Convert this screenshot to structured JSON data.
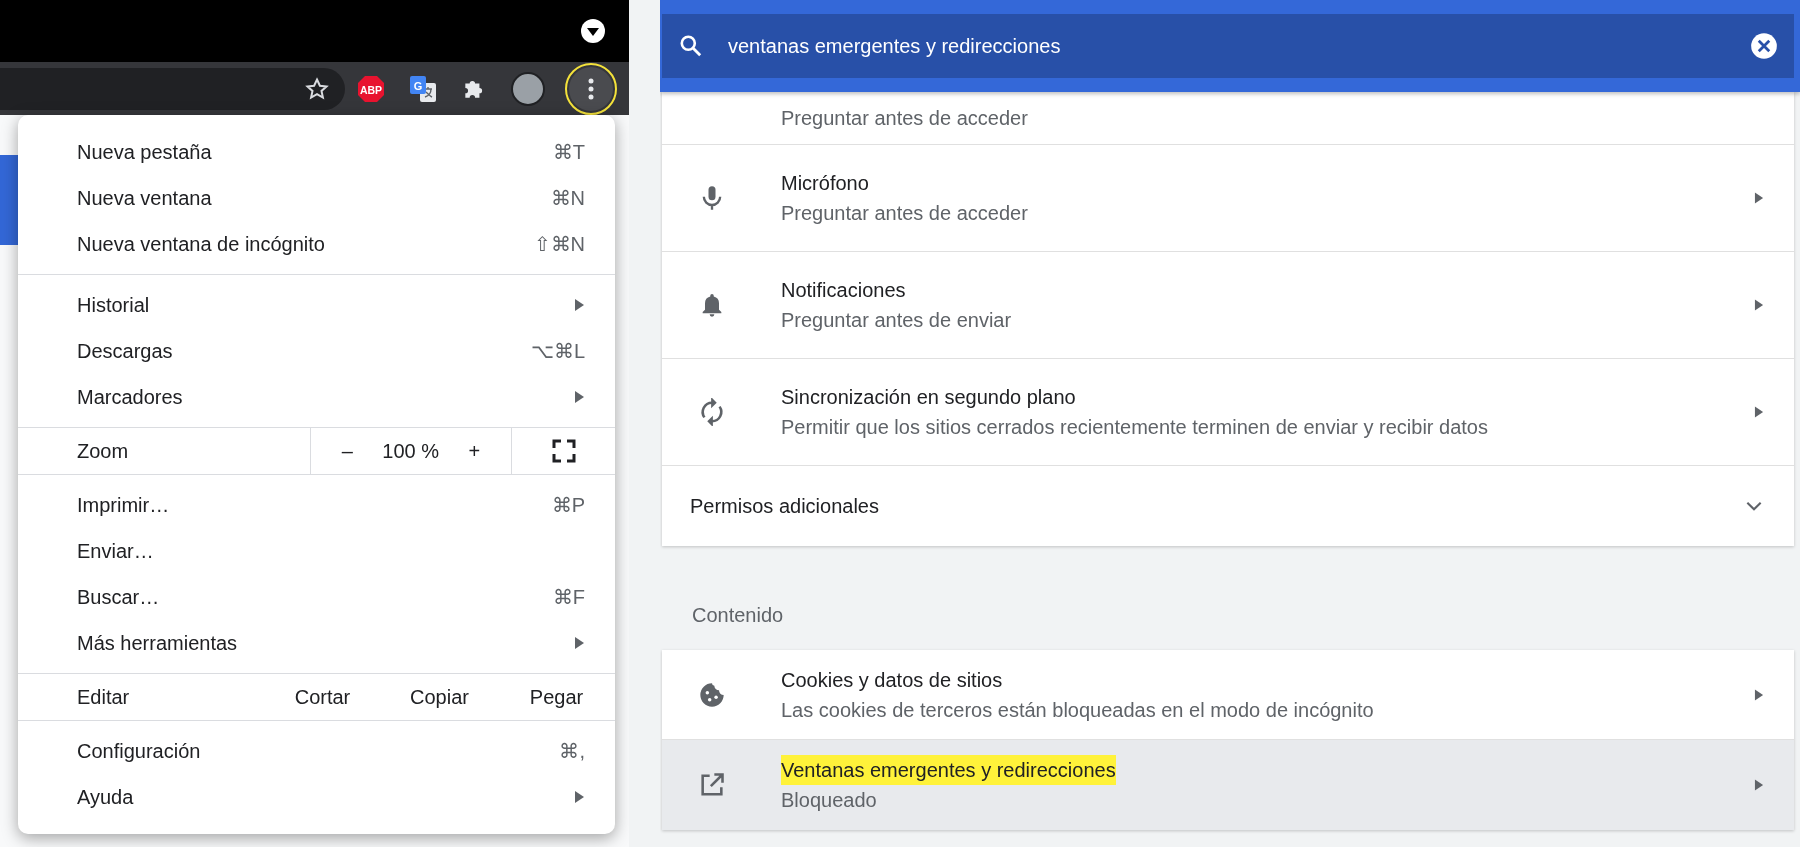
{
  "browser": {
    "toolbar": {
      "abp_label": "ABP",
      "translate_label": "G"
    }
  },
  "menu": {
    "groups": [
      [
        {
          "label": "Nueva pestaña",
          "shortcut": "⌘T",
          "submenu": false
        },
        {
          "label": "Nueva ventana",
          "shortcut": "⌘N",
          "submenu": false
        },
        {
          "label": "Nueva ventana de incógnito",
          "shortcut": "⇧⌘N",
          "submenu": false
        }
      ],
      [
        {
          "label": "Historial",
          "submenu": true
        },
        {
          "label": "Descargas",
          "shortcut": "⌥⌘L",
          "submenu": false
        },
        {
          "label": "Marcadores",
          "submenu": true
        }
      ],
      [
        {
          "kind": "zoom",
          "label": "Zoom",
          "minus": "–",
          "value": "100 %",
          "plus": "+"
        }
      ],
      [
        {
          "label": "Imprimir…",
          "shortcut": "⌘P",
          "submenu": false
        },
        {
          "label": "Enviar…",
          "submenu": false
        },
        {
          "label": "Buscar…",
          "shortcut": "⌘F",
          "submenu": false
        },
        {
          "label": "Más herramientas",
          "submenu": true
        }
      ],
      [
        {
          "kind": "edit",
          "label": "Editar",
          "buttons": [
            "Cortar",
            "Copiar",
            "Pegar"
          ]
        }
      ],
      [
        {
          "label": "Configuración",
          "shortcut": "⌘,",
          "submenu": false
        },
        {
          "label": "Ayuda",
          "submenu": true
        }
      ]
    ]
  },
  "settings": {
    "search": {
      "value": "ventanas emergentes y redirecciones"
    },
    "items": [
      {
        "kind": "link",
        "subtitle": "Preguntar antes de acceder",
        "highlighted": false
      },
      {
        "kind": "link",
        "title": "Micrófono",
        "subtitle": "Preguntar antes de acceder",
        "highlighted": false,
        "search_match": false
      },
      {
        "kind": "link",
        "title": "Notificaciones",
        "subtitle": "Preguntar antes de enviar",
        "highlighted": false,
        "search_match": false
      },
      {
        "kind": "link",
        "title": "Sincronización en segundo plano",
        "subtitle": "Permitir que los sitios cerrados recientemente terminen de enviar y recibir datos",
        "highlighted": false,
        "search_match": false
      },
      {
        "kind": "expander",
        "title": "Permisos adicionales",
        "expanded": false
      },
      {
        "kind": "heading",
        "title": "Contenido"
      },
      {
        "kind": "link",
        "title": "Cookies y datos de sitios",
        "subtitle": "Las cookies de terceros están bloqueadas en el modo de incógnito",
        "highlighted": false,
        "search_match": false
      },
      {
        "kind": "link",
        "title": "Ventanas emergentes y redirecciones",
        "subtitle": "Bloqueado",
        "highlighted": true,
        "search_match": true
      }
    ]
  }
}
